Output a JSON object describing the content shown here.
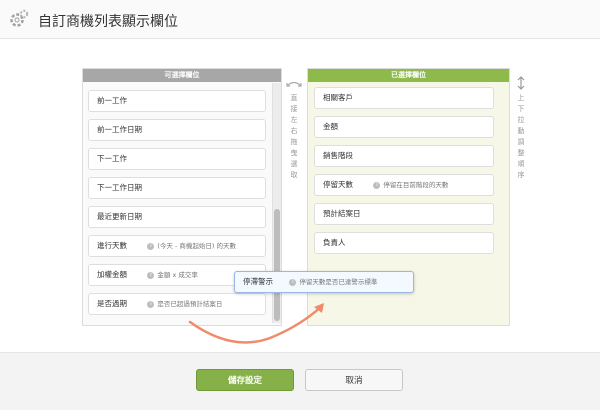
{
  "window": {
    "title": "自訂商機列表顯示欄位"
  },
  "left_panel": {
    "header": "可選擇欄位",
    "items": [
      {
        "label": "前一工作",
        "hint": ""
      },
      {
        "label": "前一工作日期",
        "hint": ""
      },
      {
        "label": "下一工作",
        "hint": ""
      },
      {
        "label": "下一工作日期",
        "hint": ""
      },
      {
        "label": "最近更新日期",
        "hint": ""
      },
      {
        "label": "進行天數",
        "hint": "(今天 - 商機起始日) 的天數"
      },
      {
        "label": "加權金額",
        "hint": "金額 x 成交率"
      },
      {
        "label": "是否過期",
        "hint": "是否已超過預計結案日"
      }
    ]
  },
  "right_panel": {
    "header": "已選擇欄位",
    "items": [
      {
        "label": "相關客戶",
        "hint": ""
      },
      {
        "label": "金額",
        "hint": ""
      },
      {
        "label": "銷售階段",
        "hint": ""
      },
      {
        "label": "停留天數",
        "hint": "停留在目前階段的天數"
      },
      {
        "label": "預計結案日",
        "hint": ""
      },
      {
        "label": "負責人",
        "hint": ""
      }
    ]
  },
  "dragging_item": {
    "label": "停滯警示",
    "hint": "停留天數是否已達警示標準"
  },
  "middle_hint": "直接左右拖曳選取",
  "side_hint": "上下拉動調整順序",
  "buttons": {
    "save": "儲存設定",
    "cancel": "取消"
  },
  "colors": {
    "accent_green": "#8dba4a",
    "drag_curve": "#f08a6a"
  }
}
